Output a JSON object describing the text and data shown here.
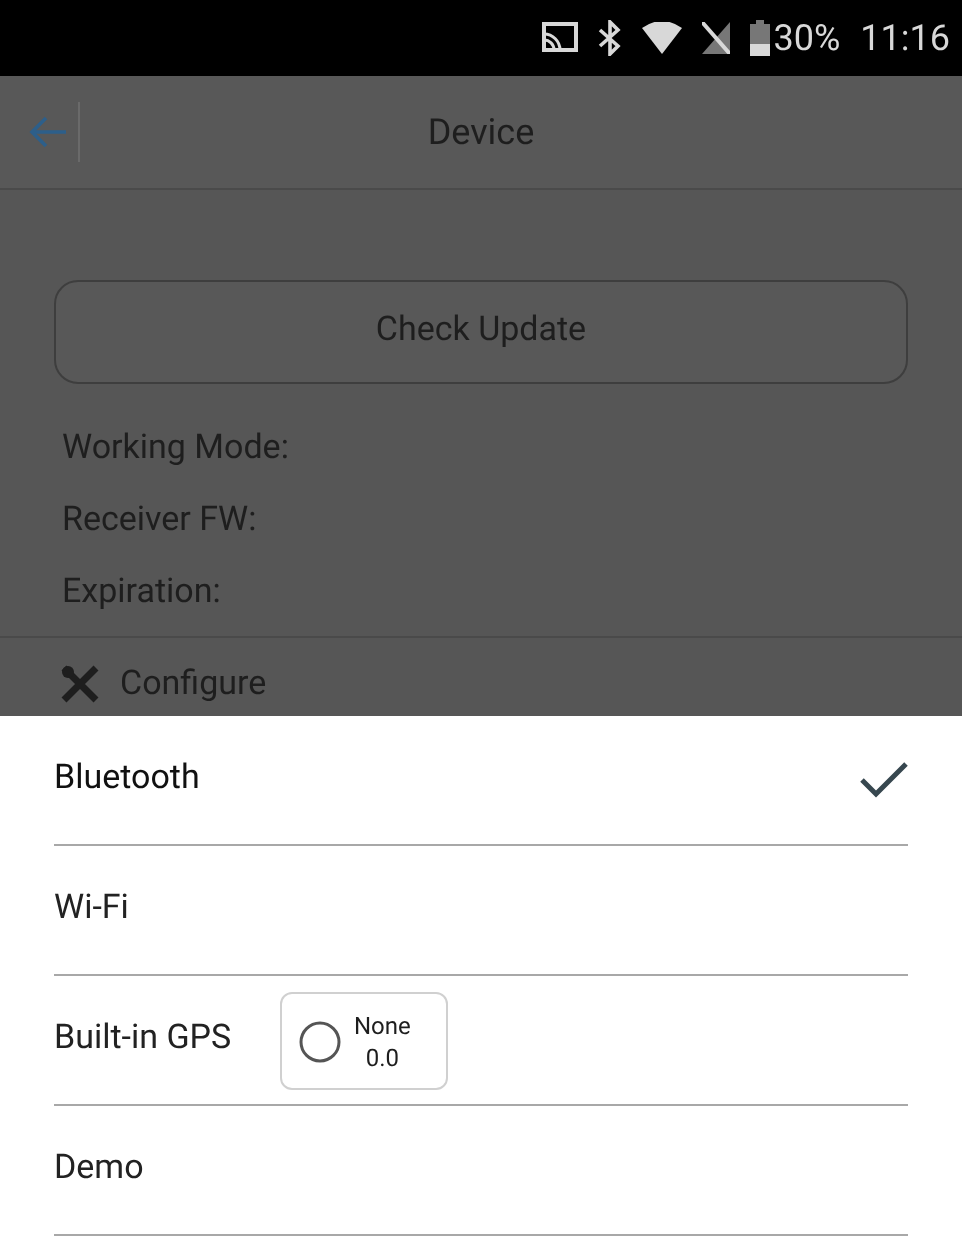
{
  "status_bar": {
    "battery": "30%",
    "time": "11:16"
  },
  "header": {
    "title": "Device"
  },
  "update_button": {
    "label": "Check Update"
  },
  "info": [
    {
      "label": "Working Mode:"
    },
    {
      "label": "Receiver FW:"
    },
    {
      "label": "Expiration:"
    }
  ],
  "section": {
    "label": "Configure"
  },
  "options": [
    {
      "label": "Bluetooth",
      "selected": true
    },
    {
      "label": "Wi-Fi",
      "selected": false
    },
    {
      "label": "Built-in GPS",
      "selected": false
    },
    {
      "label": "Demo",
      "selected": false
    }
  ],
  "floating_widget": {
    "title": "None",
    "value": "0.0"
  }
}
